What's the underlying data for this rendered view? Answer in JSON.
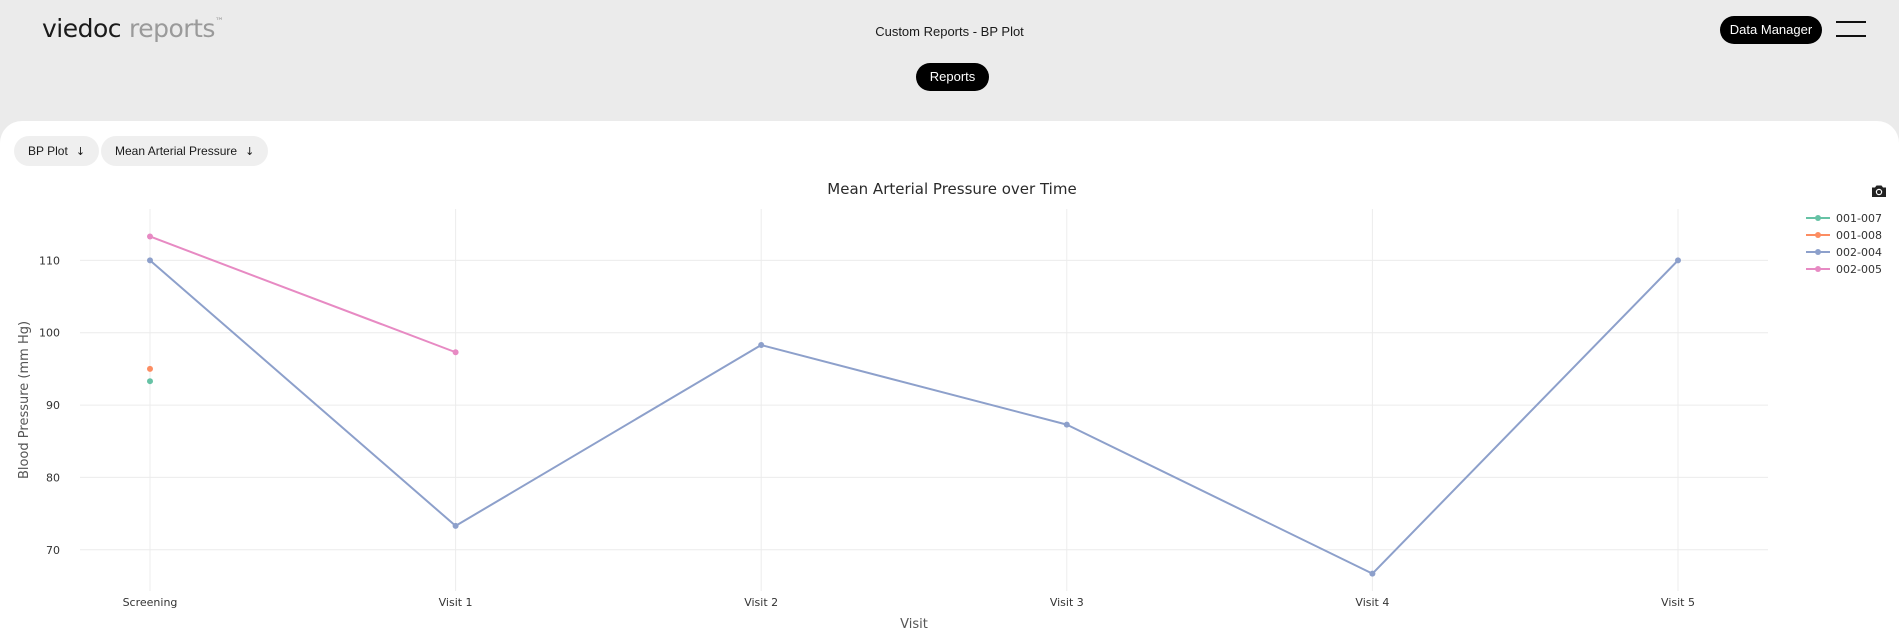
{
  "header": {
    "logo_brand": "viedoc",
    "logo_product": "reports",
    "logo_tm": "™",
    "page_title": "Custom Reports - BP Plot",
    "data_manager_label": "Data Manager",
    "reports_label": "Reports"
  },
  "filters": {
    "report_select": "BP Plot",
    "measure_select": "Mean Arterial Pressure",
    "arrow_glyph": "↓"
  },
  "icons": {
    "menu": "hamburger-menu-icon",
    "camera": "camera-icon",
    "dropdown": "arrow-down-icon"
  },
  "chart_data": {
    "type": "line",
    "title": "Mean Arterial Pressure over Time",
    "xlabel": "Visit",
    "ylabel": "Blood Pressure (mm Hg)",
    "categories": [
      "Screening",
      "Visit 1",
      "Visit 2",
      "Visit 3",
      "Visit 4",
      "Visit 5"
    ],
    "yticks": [
      70,
      80,
      90,
      100,
      110
    ],
    "ylim": [
      64.3,
      117.1
    ],
    "grid": true,
    "legend_position": "top-right",
    "series": [
      {
        "name": "001-007",
        "color": "#66c2a5",
        "values": [
          93.3,
          null,
          null,
          null,
          null,
          null
        ]
      },
      {
        "name": "001-008",
        "color": "#fc8d62",
        "values": [
          95.0,
          null,
          null,
          null,
          null,
          null
        ]
      },
      {
        "name": "002-004",
        "color": "#8da0cb",
        "values": [
          110.0,
          73.3,
          98.3,
          87.3,
          66.7,
          110.0
        ]
      },
      {
        "name": "002-005",
        "color": "#e78ac3",
        "values": [
          113.3,
          97.3,
          null,
          null,
          null,
          null
        ]
      }
    ]
  }
}
